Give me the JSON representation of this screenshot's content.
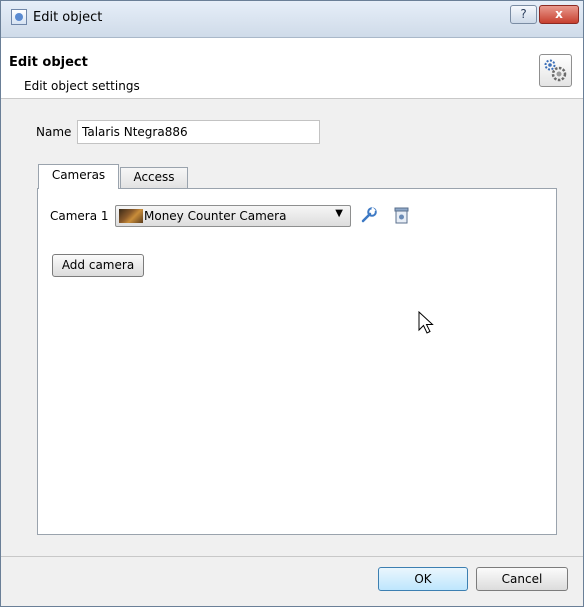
{
  "window": {
    "title": "Edit object",
    "help_label": "?",
    "close_label": "x"
  },
  "header": {
    "title": "Edit object",
    "subtitle": "Edit object settings",
    "icon": "gears-icon"
  },
  "form": {
    "name_label": "Name",
    "name_value": "Talaris Ntegra886"
  },
  "tabs": [
    {
      "label": "Cameras",
      "active": true
    },
    {
      "label": "Access",
      "active": false
    }
  ],
  "cameras": {
    "camera_label": "Camera 1",
    "selected_camera": "Money Counter Camera",
    "edit_icon": "wrench-icon",
    "remove_icon": "remove-icon",
    "add_label": "Add camera"
  },
  "footer": {
    "ok_label": "OK",
    "cancel_label": "Cancel"
  }
}
